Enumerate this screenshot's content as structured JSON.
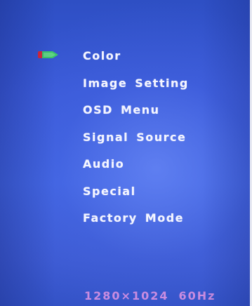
{
  "osd": {
    "menu_items": [
      {
        "label": "Color",
        "selected": true
      },
      {
        "label": "Image Setting",
        "selected": false
      },
      {
        "label": "OSD Menu",
        "selected": false
      },
      {
        "label": "Signal Source",
        "selected": false
      },
      {
        "label": "Audio",
        "selected": false
      },
      {
        "label": "Special",
        "selected": false
      },
      {
        "label": "Factory Mode",
        "selected": false
      }
    ],
    "selection_icon": "selection-arrow-icon",
    "status": {
      "resolution": "1280×1024",
      "refresh_rate": "60Hz"
    }
  },
  "colors": {
    "background": "#3a5ad8",
    "menu_text": "#f4f5ff",
    "status_text": "#c98ce0",
    "cursor_red": "#d8283a",
    "cursor_green": "#3cc66a"
  }
}
